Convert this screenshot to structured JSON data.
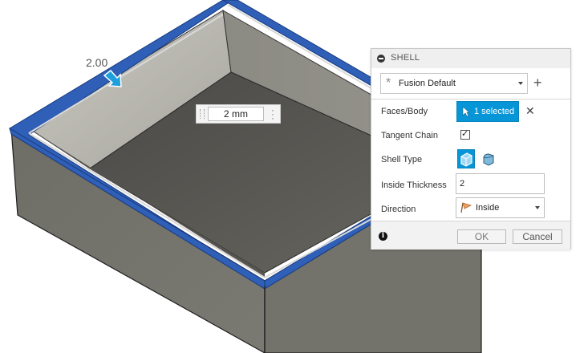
{
  "viewport": {
    "dimension_label": "2.00",
    "inplace_value": "2 mm"
  },
  "dialog": {
    "title": "SHELL",
    "preset": {
      "value": "Fusion Default"
    },
    "faces_body": {
      "label": "Faces/Body",
      "selection": "1 selected"
    },
    "tangent_chain": {
      "label": "Tangent Chain",
      "checked": true
    },
    "shell_type": {
      "label": "Shell Type"
    },
    "inside_thickness": {
      "label": "Inside Thickness",
      "value": "2"
    },
    "direction": {
      "label": "Direction",
      "value": "Inside"
    },
    "buttons": {
      "ok": "OK",
      "cancel": "Cancel"
    }
  },
  "colors": {
    "accent": "#0696d7",
    "selected_face": "#2f5fb6",
    "body_gray": "#6f6e69"
  },
  "icons": {
    "collapse": "collapse-icon",
    "preset": "asterisk-icon",
    "add": "plus-icon",
    "select": "cursor-icon",
    "clear": "close-icon",
    "info": "info-icon",
    "direction": "direction-icon"
  }
}
